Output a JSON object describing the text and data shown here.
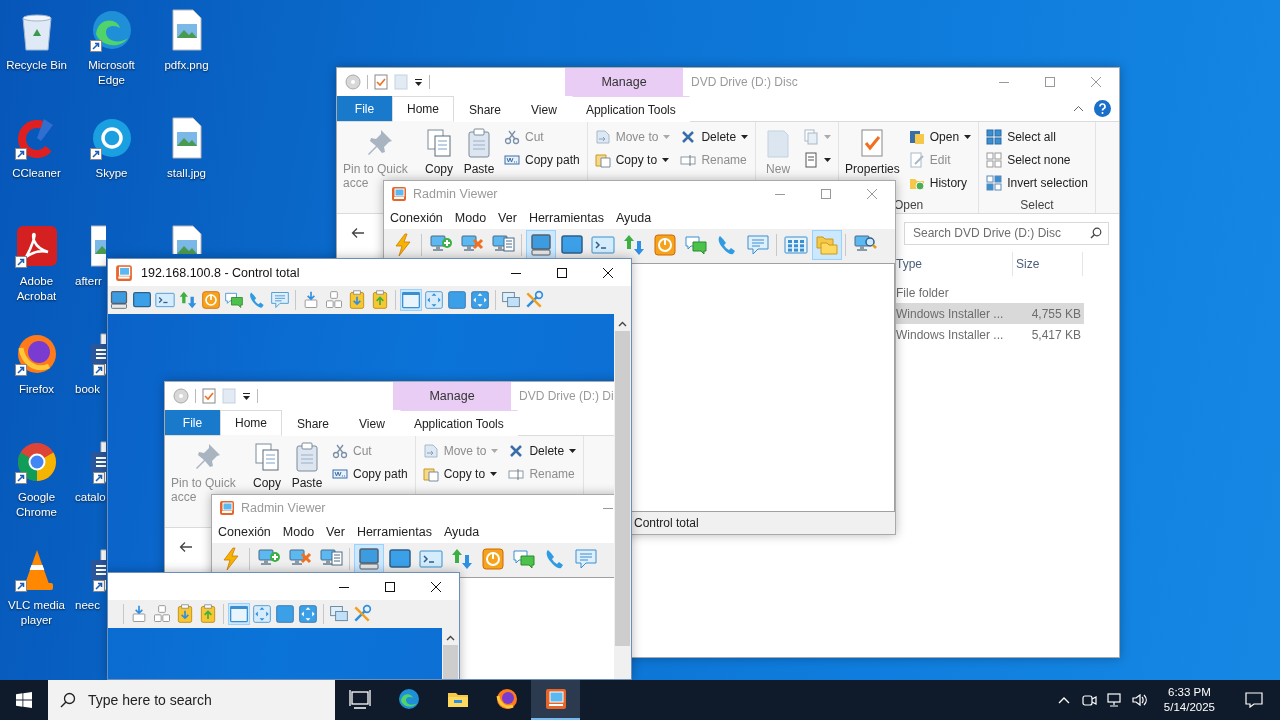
{
  "desktop": {
    "icons": [
      {
        "kind": "recycle-bin",
        "label": "Recycle Bin",
        "shortcut": false,
        "cut": false
      },
      {
        "kind": "ccleaner",
        "label": "CCleaner",
        "shortcut": true,
        "cut": false
      },
      {
        "kind": "acrobat",
        "label": "Adobe Acrobat",
        "shortcut": true,
        "cut": false
      },
      {
        "kind": "firefox",
        "label": "Firefox",
        "shortcut": true,
        "cut": false
      },
      {
        "kind": "chrome",
        "label": "Google Chrome",
        "shortcut": true,
        "cut": false
      },
      {
        "kind": "vlc",
        "label": "VLC media player",
        "shortcut": true,
        "cut": false
      },
      {
        "kind": "edge",
        "label": "Microsoft Edge",
        "shortcut": true,
        "cut": false
      },
      {
        "kind": "skype",
        "label": "Skype",
        "shortcut": true,
        "cut": false
      },
      {
        "kind": "image",
        "label": "afterr",
        "shortcut": false,
        "cut": true
      },
      {
        "kind": "word",
        "label": "book",
        "shortcut": true,
        "cut": true
      },
      {
        "kind": "word",
        "label": "catalo",
        "shortcut": true,
        "cut": true
      },
      {
        "kind": "word",
        "label": "neec",
        "shortcut": true,
        "cut": true
      },
      {
        "kind": "image",
        "label": "pdfx.png",
        "shortcut": false,
        "cut": false
      },
      {
        "kind": "image",
        "label": "stall.jpg",
        "shortcut": false,
        "cut": false
      },
      {
        "kind": "image",
        "shortcut": false,
        "cut": false
      }
    ]
  },
  "explorer": {
    "title": "DVD Drive (D:) Disc",
    "active": false,
    "context_header": "Manage",
    "caption_buttons": [
      {
        "kind": "minimize"
      },
      {
        "kind": "maximize"
      },
      {
        "kind": "close"
      }
    ],
    "file_tab": "File",
    "tabs": [
      {
        "label": "Home",
        "kind": "standard",
        "selected": true
      },
      {
        "label": "Share",
        "kind": "standard",
        "selected": false
      },
      {
        "label": "View",
        "kind": "standard",
        "selected": false
      },
      {
        "label": "Application Tools",
        "kind": "contextual",
        "selected": false
      }
    ],
    "ribbon_tools": [
      {
        "kind": "collapse"
      },
      {
        "kind": "help"
      }
    ],
    "groups": [
      {
        "columns": [
          [
            {
              "kind": "pin",
              "label": "Pin to Quick acce",
              "disabled": true
            }
          ],
          [
            {
              "kind": "copy",
              "label": "Copy",
              "disabled": false
            }
          ],
          [
            {
              "kind": "paste",
              "label": "Paste",
              "disabled": false
            }
          ],
          [
            {
              "kind": "cut",
              "label": "Cut",
              "disabled": true,
              "menu": false
            },
            {
              "kind": "copy-path",
              "label": "Copy path",
              "disabled": false,
              "menu": false
            }
          ]
        ]
      },
      {
        "columns": [
          [
            {
              "kind": "move-to",
              "label": "Move to",
              "disabled": true,
              "menu": true
            },
            {
              "kind": "copy-to",
              "label": "Copy to",
              "disabled": false,
              "menu": true
            }
          ],
          [
            {
              "kind": "delete",
              "label": "Delete",
              "disabled": false,
              "menu": true
            },
            {
              "kind": "rename",
              "label": "Rename",
              "disabled": true,
              "menu": false
            }
          ]
        ]
      },
      {
        "columns": [
          [
            {
              "kind": "new-folder",
              "label": "New",
              "disabled": true
            }
          ],
          [
            {
              "kind": "new-item",
              "disabled": true,
              "menu": true
            },
            {
              "kind": "easy-access",
              "disabled": false,
              "menu": true
            }
          ]
        ]
      },
      {
        "label": "Open",
        "columns": [
          [
            {
              "kind": "properties",
              "label": "Properties",
              "disabled": false
            }
          ],
          [
            {
              "kind": "open",
              "label": "Open",
              "disabled": false,
              "menu": true
            },
            {
              "kind": "edit",
              "label": "Edit",
              "disabled": true,
              "menu": false
            },
            {
              "kind": "history",
              "label": "History",
              "disabled": false,
              "menu": false
            }
          ]
        ]
      },
      {
        "label": "Select",
        "columns": [
          [
            {
              "kind": "select-all",
              "label": "Select all",
              "disabled": false,
              "menu": false
            },
            {
              "kind": "select-none",
              "label": "Select none",
              "disabled": false,
              "menu": false
            },
            {
              "kind": "invert",
              "label": "Invert selection",
              "disabled": false,
              "menu": false
            }
          ]
        ]
      }
    ],
    "nav": [
      {
        "kind": "back"
      }
    ],
    "search": {
      "placeholder": "Search DVD Drive (D:) Disc"
    },
    "columns": [
      "Type",
      "Size"
    ],
    "rows": [
      {
        "type": "File folder",
        "selected": false
      },
      {
        "type": "Windows Installer ...",
        "size": "4,755 KB",
        "selected": true
      },
      {
        "type": "Windows Installer ...",
        "size": "5,417 KB",
        "selected": false
      }
    ]
  },
  "radmin": {
    "title": "Radmin Viewer",
    "active": false,
    "caption_buttons": [
      {
        "kind": "minimize"
      },
      {
        "kind": "maximize"
      },
      {
        "kind": "close"
      }
    ],
    "menu": [
      "Conexión",
      "Modo",
      "Ver",
      "Herramientas",
      "Ayuda"
    ],
    "toolbar": [
      {
        "kind": "bolt",
        "selected": false
      },
      {
        "kind": "separator"
      },
      {
        "kind": "pc-add",
        "selected": false
      },
      {
        "kind": "pc-remove",
        "selected": false
      },
      {
        "kind": "pc-list",
        "selected": false
      },
      {
        "kind": "separator"
      },
      {
        "kind": "full-control",
        "selected": true
      },
      {
        "kind": "view-only",
        "selected": false
      },
      {
        "kind": "telnet",
        "selected": false
      },
      {
        "kind": "transfer",
        "selected": false
      },
      {
        "kind": "shutdown",
        "selected": false
      },
      {
        "kind": "chat",
        "selected": false
      },
      {
        "kind": "voice",
        "selected": false
      },
      {
        "kind": "message",
        "selected": false
      },
      {
        "kind": "separator"
      },
      {
        "kind": "grid",
        "selected": false
      },
      {
        "kind": "folders",
        "selected": true
      },
      {
        "kind": "separator"
      },
      {
        "kind": "pc-search",
        "selected": false
      }
    ],
    "status": "Control total"
  },
  "control": {
    "title": "192.168.100.8 - Control total",
    "active": true,
    "caption_buttons": [
      {
        "kind": "minimize"
      },
      {
        "kind": "maximize"
      },
      {
        "kind": "close"
      }
    ],
    "toolbar": [
      {
        "kind": "full-control",
        "selected": false
      },
      {
        "kind": "view-only",
        "selected": false
      },
      {
        "kind": "telnet",
        "selected": false
      },
      {
        "kind": "transfer",
        "selected": false
      },
      {
        "kind": "shutdown",
        "selected": false
      },
      {
        "kind": "chat",
        "selected": false
      },
      {
        "kind": "voice",
        "selected": false
      },
      {
        "kind": "message",
        "selected": false
      },
      {
        "kind": "separator"
      },
      {
        "kind": "download",
        "selected": false
      },
      {
        "kind": "keys",
        "selected": false
      },
      {
        "kind": "clip-in",
        "selected": false
      },
      {
        "kind": "clip-out",
        "selected": false
      },
      {
        "kind": "separator"
      },
      {
        "kind": "window",
        "selected": true
      },
      {
        "kind": "fit",
        "selected": false
      },
      {
        "kind": "fullscreen",
        "selected": false
      },
      {
        "kind": "fit-full",
        "selected": false
      },
      {
        "kind": "separator"
      },
      {
        "kind": "screens",
        "selected": false
      },
      {
        "kind": "tools",
        "selected": false
      }
    ],
    "remote_view": {
      "explorer": {
        "title": "DVD Drive (D:) Di",
        "active": false,
        "context_header": "Manage",
        "file_tab": "File",
        "tabs": [
          {
            "label": "Home",
            "kind": "standard",
            "selected": true
          },
          {
            "label": "Share",
            "kind": "standard",
            "selected": false
          },
          {
            "label": "View",
            "kind": "standard",
            "selected": false
          },
          {
            "label": "Application Tools",
            "kind": "contextual",
            "selected": false
          }
        ],
        "groups": [
          {
            "columns": [
              [
                {
                  "kind": "pin",
                  "label": "Pin to Quick acce",
                  "disabled": true
                }
              ],
              [
                {
                  "kind": "copy",
                  "label": "Copy",
                  "disabled": false
                }
              ],
              [
                {
                  "kind": "paste",
                  "label": "Paste",
                  "disabled": false
                }
              ],
              [
                {
                  "kind": "cut",
                  "label": "Cut",
                  "disabled": true,
                  "menu": false
                },
                {
                  "kind": "copy-path",
                  "label": "Copy path",
                  "disabled": false,
                  "menu": false
                }
              ]
            ]
          },
          {
            "columns": [
              [
                {
                  "kind": "move-to",
                  "label": "Move to",
                  "disabled": true,
                  "menu": true
                },
                {
                  "kind": "copy-to",
                  "label": "Copy to",
                  "disabled": false,
                  "menu": true
                }
              ],
              [
                {
                  "kind": "delete",
                  "label": "Delete",
                  "disabled": false,
                  "menu": true
                },
                {
                  "kind": "rename",
                  "label": "Rename",
                  "disabled": true,
                  "menu": false
                }
              ]
            ]
          }
        ],
        "nav": [
          {
            "kind": "back"
          }
        ]
      },
      "radmin": {
        "title": "Radmin Viewer",
        "active": false,
        "caption_buttons": [
          {
            "kind": "minimize"
          }
        ],
        "menu": [
          "Conexión",
          "Modo",
          "Ver",
          "Herramientas",
          "Ayuda"
        ],
        "toolbar": [
          {
            "kind": "bolt",
            "selected": false
          },
          {
            "kind": "separator"
          },
          {
            "kind": "pc-add",
            "selected": false
          },
          {
            "kind": "pc-remove",
            "selected": false
          },
          {
            "kind": "pc-list",
            "selected": false
          },
          {
            "kind": "separator"
          },
          {
            "kind": "full-control",
            "selected": true
          },
          {
            "kind": "view-only",
            "selected": false
          },
          {
            "kind": "telnet",
            "selected": false
          },
          {
            "kind": "transfer",
            "selected": false
          },
          {
            "kind": "shutdown",
            "selected": false
          },
          {
            "kind": "chat",
            "selected": false
          },
          {
            "kind": "voice",
            "selected": false
          },
          {
            "kind": "message",
            "selected": false
          }
        ]
      },
      "control": {
        "active": true,
        "caption_buttons": [
          {
            "kind": "minimize"
          },
          {
            "kind": "maximize"
          },
          {
            "kind": "close"
          }
        ],
        "toolbar": [
          {
            "kind": "separator"
          },
          {
            "kind": "download",
            "selected": false
          },
          {
            "kind": "keys",
            "selected": false
          },
          {
            "kind": "clip-in",
            "selected": false
          },
          {
            "kind": "clip-out",
            "selected": false
          },
          {
            "kind": "separator"
          },
          {
            "kind": "window",
            "selected": true
          },
          {
            "kind": "fit",
            "selected": false
          },
          {
            "kind": "fullscreen",
            "selected": false
          },
          {
            "kind": "fit-full",
            "selected": false
          },
          {
            "kind": "separator"
          },
          {
            "kind": "screens",
            "selected": false
          },
          {
            "kind": "tools",
            "selected": false
          }
        ]
      }
    }
  },
  "taskbar": {
    "search": {
      "placeholder": "Type here to search"
    },
    "apps": [
      {
        "kind": "task-view",
        "selected": false
      },
      {
        "kind": "edge",
        "selected": false
      },
      {
        "kind": "explorer",
        "selected": false
      },
      {
        "kind": "firefox",
        "selected": false
      },
      {
        "kind": "radmin",
        "selected": true
      }
    ],
    "tray": [
      {
        "kind": "chevron"
      },
      {
        "kind": "meet"
      },
      {
        "kind": "network"
      },
      {
        "kind": "volume"
      }
    ],
    "clock": {
      "time": "6:33 PM",
      "date": "5/14/2025"
    }
  }
}
